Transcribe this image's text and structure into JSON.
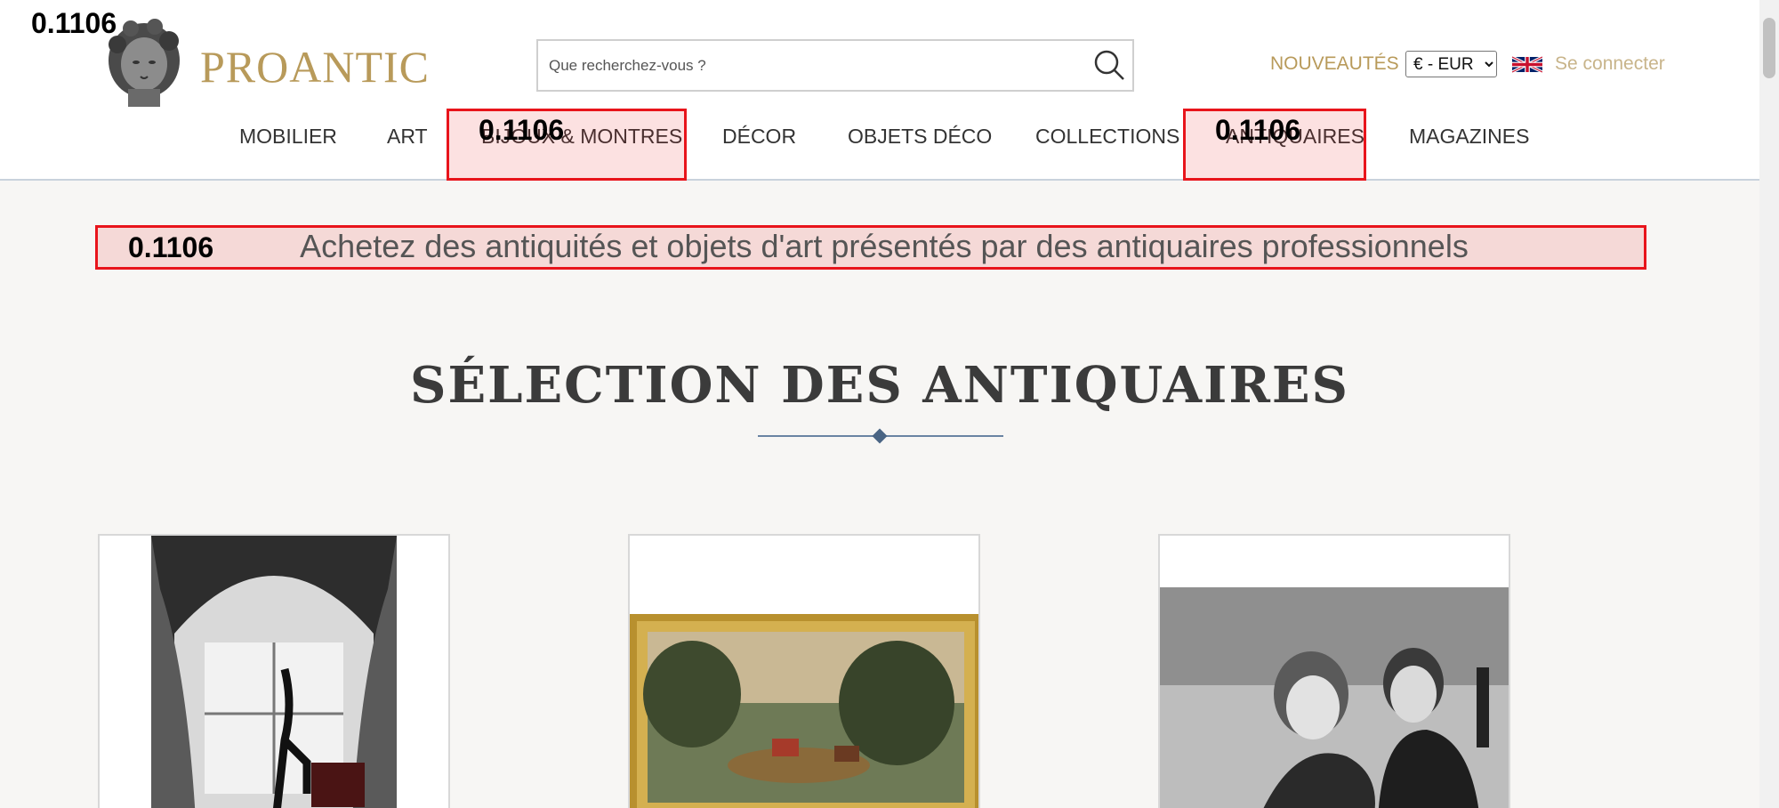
{
  "header": {
    "brand": "PROANTIC",
    "search": {
      "placeholder": "Que recherchez-vous ?"
    },
    "nouveautes": "NOUVEAUTÉS",
    "currency": {
      "selected": "€ - EUR"
    },
    "login": "Se connecter"
  },
  "nav": {
    "items": [
      {
        "label": "MOBILIER"
      },
      {
        "label": "ART"
      },
      {
        "label": "BIJOUX & MONTRES"
      },
      {
        "label": "DÉCOR"
      },
      {
        "label": "OBJETS DÉCO"
      },
      {
        "label": "COLLECTIONS"
      },
      {
        "label": "ANTIQUAIRES"
      },
      {
        "label": "MAGAZINES"
      }
    ]
  },
  "annotations": {
    "corner_label": "0.1106",
    "bijoux_label": "0.1106",
    "antiquaires_label": "0.1106",
    "tagline_label": "0.1106",
    "color": "#e8141b"
  },
  "tagline": "Achetez des antiquités et objets d'art présentés par des antiquaires professionnels",
  "section": {
    "title": "SÉLECTION DES ANTIQUAIRES"
  },
  "colors": {
    "brand_gold": "#b89a5a",
    "accent_blue": "#4a6584",
    "background": "#f7f6f4"
  }
}
